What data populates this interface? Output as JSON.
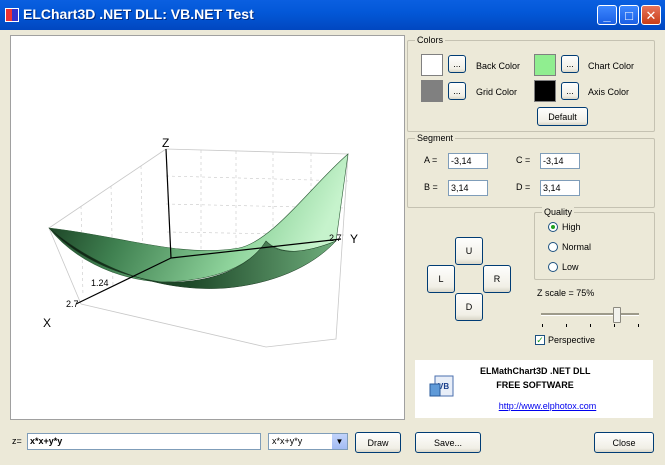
{
  "window": {
    "title": "ELChart3D .NET DLL: VB.NET Test",
    "minimize": "_",
    "maximize": "□",
    "close": "✕"
  },
  "chart": {
    "axes": {
      "z": "Z",
      "y": "Y",
      "x": "X"
    },
    "ticks": {
      "y": "2.7",
      "x_near": "1.24",
      "x_far": "2.7"
    }
  },
  "colors": {
    "group_label": "Colors",
    "back_color": {
      "label": "Back Color",
      "value": "#ffffff"
    },
    "grid_color": {
      "label": "Grid Color",
      "value": "#808080"
    },
    "chart_color": {
      "label": "Chart Color",
      "value": "#90ee90"
    },
    "axis_color": {
      "label": "Axis Color",
      "value": "#000000"
    },
    "ellipsis": "...",
    "default_button": "Default"
  },
  "segment": {
    "group_label": "Segment",
    "a_label": "A =",
    "a_value": "-3,14",
    "b_label": "B =",
    "b_value": "3,14",
    "c_label": "C =",
    "c_value": "-3,14",
    "d_label": "D =",
    "d_value": "3,14"
  },
  "nav": {
    "up": "U",
    "left": "L",
    "right": "R",
    "down": "D"
  },
  "quality": {
    "group_label": "Quality",
    "options": [
      "High",
      "Normal",
      "Low"
    ],
    "selected": "High"
  },
  "zscale": {
    "label": "Z scale = 75%",
    "value": 75
  },
  "perspective": {
    "label": "Perspective",
    "checked": true
  },
  "info": {
    "title": "ELMathChart3D .NET DLL",
    "subtitle": "FREE SOFTWARE",
    "link": "http://www.elphotox.com"
  },
  "bottom": {
    "z_label": "z=",
    "expression": "x*x+y*y",
    "preset": "x*x+y*y",
    "draw_button": "Draw",
    "save_button": "Save...",
    "close_button": "Close"
  }
}
